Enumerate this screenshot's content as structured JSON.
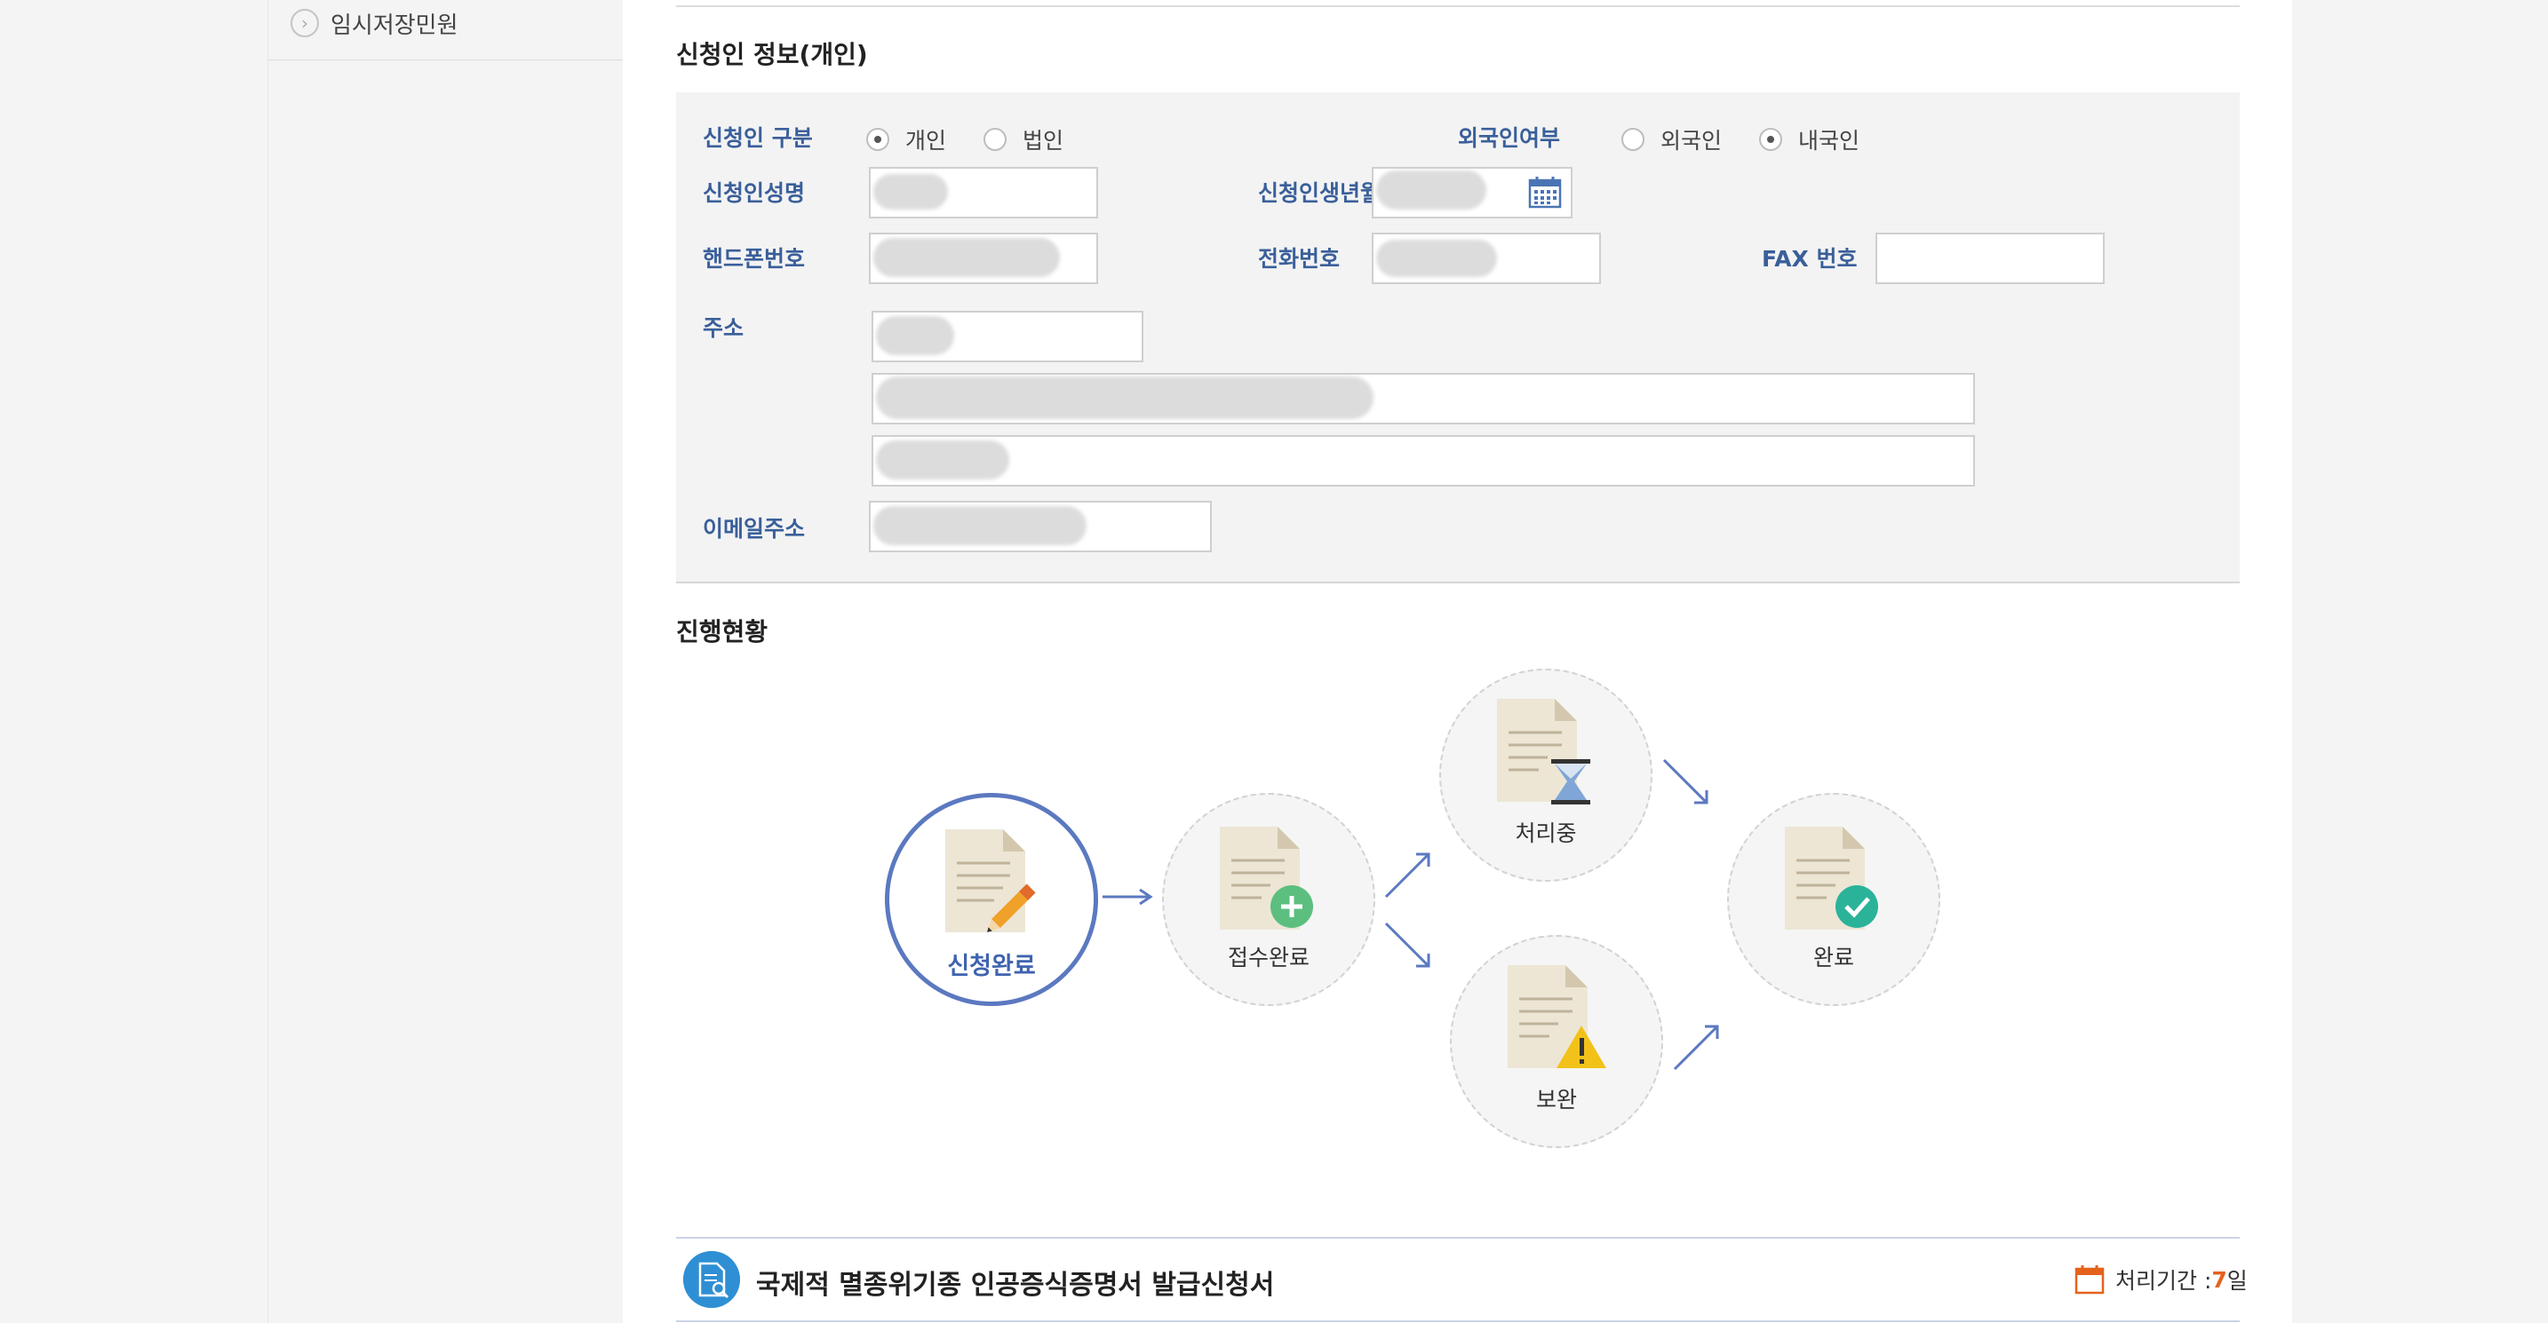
{
  "sidebar": {
    "item_label": "임시저장민원"
  },
  "applicant_section": {
    "title": "신청인 정보(개인)",
    "type_label": "신청인 구분",
    "type_options": [
      "개인",
      "법인"
    ],
    "type_selected": "개인",
    "foreigner_label": "외국인여부",
    "foreigner_options": [
      "외국인",
      "내국인"
    ],
    "foreigner_selected": "내국인",
    "name_label": "신청인성명",
    "birth_label": "신청인생년월일",
    "mobile_label": "핸드폰번호",
    "phone_label": "전화번호",
    "fax_label": "FAX 번호",
    "address_label": "주소",
    "email_label": "이메일주소"
  },
  "progress": {
    "title": "진행현황",
    "steps": {
      "applied": "신청완료",
      "received": "접수완료",
      "processing": "처리중",
      "supplement": "보완",
      "done": "완료"
    }
  },
  "document": {
    "title": "국제적 멸종위기종 인공증식증명서 발급신청서",
    "period_label": "처리기간 : ",
    "period_value": "7",
    "period_unit": "일"
  },
  "colors": {
    "label_blue": "#3a5f9a",
    "active_circle": "#5b79c0",
    "accent_orange": "#e5621d"
  }
}
